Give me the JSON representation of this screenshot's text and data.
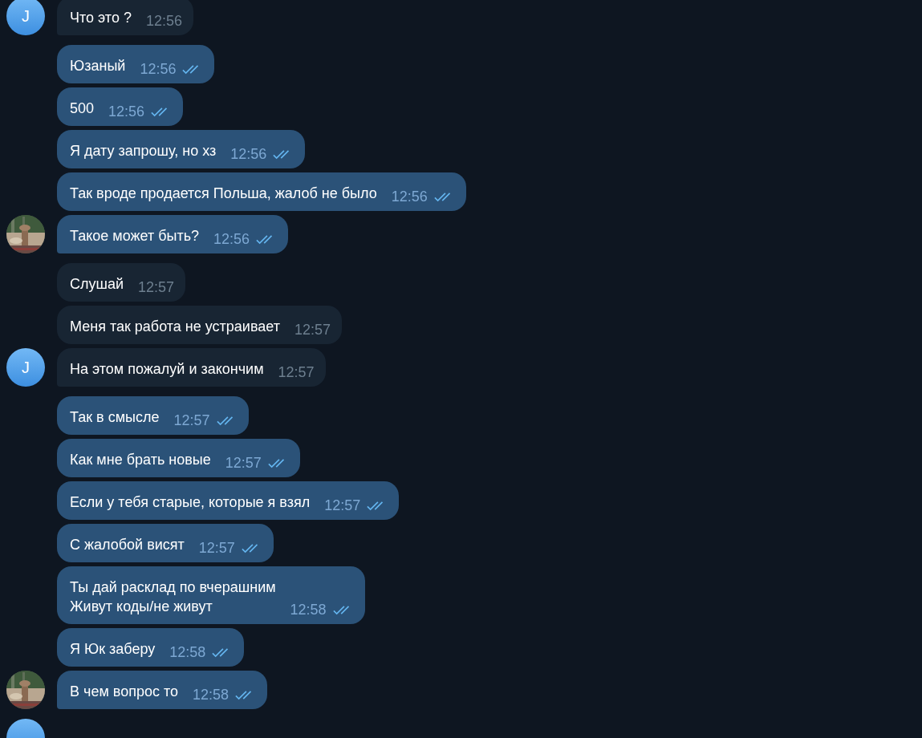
{
  "chat": {
    "groups": [
      {
        "kind": "incoming",
        "avatar": {
          "kind": "letter",
          "letter": "J"
        },
        "messages": [
          {
            "text": "Что это ?",
            "time": "12:56"
          }
        ]
      },
      {
        "kind": "outgoing",
        "messages": [
          {
            "text": "Юзаный",
            "time": "12:56",
            "read": true
          },
          {
            "text": "500",
            "time": "12:56",
            "read": true
          },
          {
            "text": "Я дату запрошу, но хз",
            "time": "12:56",
            "read": true
          },
          {
            "text": "Так вроде продается Польша, жалоб не было",
            "time": "12:56",
            "read": true
          },
          {
            "text": "Такое может быть?",
            "time": "12:56",
            "read": true
          }
        ]
      },
      {
        "kind": "incoming",
        "avatar": {
          "kind": "letter",
          "letter": "J"
        },
        "messages": [
          {
            "text": "Слушай",
            "time": "12:57"
          },
          {
            "text": "Меня так работа не устраивает",
            "time": "12:57"
          },
          {
            "text": "На этом пожалуй и закончим",
            "time": "12:57"
          }
        ]
      },
      {
        "kind": "outgoing",
        "messages": [
          {
            "text": "Так в смысле",
            "time": "12:57",
            "read": true
          },
          {
            "text": "Как мне брать новые",
            "time": "12:57",
            "read": true
          },
          {
            "text": "Если у тебя старые, которые я взял",
            "time": "12:57",
            "read": true
          },
          {
            "text": "С жалобой висят",
            "time": "12:57",
            "read": true
          },
          {
            "text": "Ты дай расклад по вчерашним\nЖивут коды/не живут",
            "time": "12:58",
            "read": true
          },
          {
            "text": "Я Юк заберу",
            "time": "12:58",
            "read": true
          },
          {
            "text": "В чем вопрос то",
            "time": "12:58",
            "read": true
          }
        ]
      },
      {
        "kind": "incoming",
        "avatar": {
          "kind": "blank"
        }
      }
    ]
  }
}
